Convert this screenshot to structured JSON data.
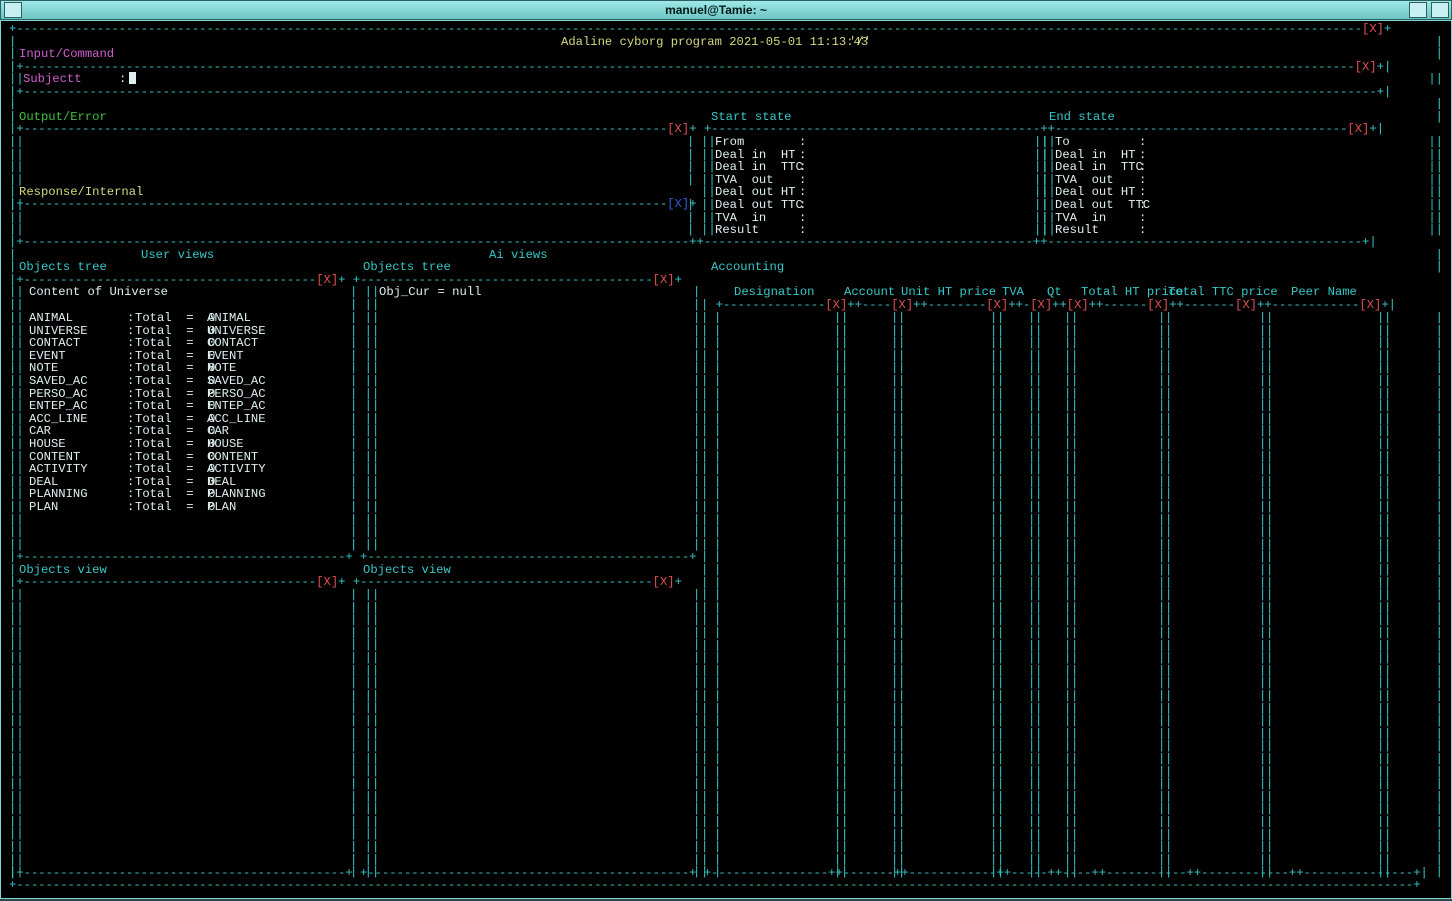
{
  "window": {
    "title": "manuel@Tamie: ~"
  },
  "header": {
    "program": "Adaline cyborg program 2021-05-01 11:13:43",
    "path": "'/'",
    "close": "[X]"
  },
  "input_panel": {
    "label": "Input/Command",
    "prompt_label": "Subjectt",
    "prompt_sep": ":",
    "close": "[X]"
  },
  "output_panel": {
    "label": "Output/Error",
    "close": "[X]"
  },
  "response_panel": {
    "label": "Response/Internal",
    "close": "[X]"
  },
  "start_state": {
    "label": "Start state",
    "rows": [
      {
        "k": "From",
        "v": ":"
      },
      {
        "k": "Deal in  HT",
        "v": ":"
      },
      {
        "k": "Deal in  TTC",
        "v": ":"
      },
      {
        "k": "TVA  out",
        "v": ":"
      },
      {
        "k": "Deal out HT",
        "v": ":"
      },
      {
        "k": "Deal out TTC",
        "v": ":"
      },
      {
        "k": "TVA  in",
        "v": ":"
      },
      {
        "k": "Result",
        "v": ":"
      }
    ]
  },
  "end_state": {
    "label": "End state",
    "rows": [
      {
        "k": "To",
        "v": ":"
      },
      {
        "k": "Deal in  HT",
        "v": ":"
      },
      {
        "k": "Deal in  TTC",
        "v": ":"
      },
      {
        "k": "TVA  out",
        "v": ":"
      },
      {
        "k": "Deal out HT",
        "v": ":"
      },
      {
        "k": "Deal out  TTC",
        "v": ":"
      },
      {
        "k": "TVA  in",
        "v": ":"
      },
      {
        "k": "Result",
        "v": ":"
      }
    ]
  },
  "user_views": {
    "label": "User views"
  },
  "ai_views": {
    "label": "Ai views"
  },
  "objects_tree_user": {
    "label": "Objects tree",
    "close": "[X]",
    "content_title": "Content of Universe",
    "rows": [
      {
        "name": "ANIMAL",
        "total": "Total  =  0",
        "type": "ANIMAL"
      },
      {
        "name": "UNIVERSE",
        "total": "Total  =  0",
        "type": "UNIVERSE"
      },
      {
        "name": "CONTACT",
        "total": "Total  =  0",
        "type": "CONTACT"
      },
      {
        "name": "EVENT",
        "total": "Total  =  0",
        "type": "EVENT"
      },
      {
        "name": "NOTE",
        "total": "Total  =  0",
        "type": "NOTE"
      },
      {
        "name": "SAVED_AC",
        "total": "Total  =  0",
        "type": "SAVED_AC"
      },
      {
        "name": "PERSO_AC",
        "total": "Total  =  0",
        "type": "PERSO_AC"
      },
      {
        "name": "ENTEP_AC",
        "total": "Total  =  0",
        "type": "ENTEP_AC"
      },
      {
        "name": "ACC_LINE",
        "total": "Total  =  0",
        "type": "ACC_LINE"
      },
      {
        "name": "CAR",
        "total": "Total  =  0",
        "type": "CAR"
      },
      {
        "name": "HOUSE",
        "total": "Total  =  0",
        "type": "HOUSE"
      },
      {
        "name": "CONTENT",
        "total": "Total  =  0",
        "type": "CONTENT"
      },
      {
        "name": "ACTIVITY",
        "total": "Total  =  0",
        "type": "ACTIVITY"
      },
      {
        "name": "DEAL",
        "total": "Total  =  0",
        "type": "DEAL"
      },
      {
        "name": "PLANNING",
        "total": "Total  =  0",
        "type": "PLANNING"
      },
      {
        "name": "PLAN",
        "total": "Total  =  0",
        "type": "PLAN"
      }
    ]
  },
  "objects_tree_ai": {
    "label": "Objects tree",
    "close": "[X]",
    "content": "Obj_Cur = null"
  },
  "objects_view_user": {
    "label": "Objects view",
    "close": "[X]"
  },
  "objects_view_ai": {
    "label": "Objects view",
    "close": "[X]"
  },
  "accounting": {
    "label": "Accounting",
    "columns": [
      {
        "name": "Designation",
        "close": "[X]"
      },
      {
        "name": "Account",
        "close": "[X]"
      },
      {
        "name": "Unit HT price",
        "close": "[X]"
      },
      {
        "name": "TVA",
        "close": "[X]"
      },
      {
        "name": "Qt",
        "close": "[X]"
      },
      {
        "name": "Total HT price",
        "close": "[X]"
      },
      {
        "name": "Total TTC price",
        "close": "[X]"
      },
      {
        "name": "Peer Name",
        "close": "[X]"
      }
    ]
  }
}
